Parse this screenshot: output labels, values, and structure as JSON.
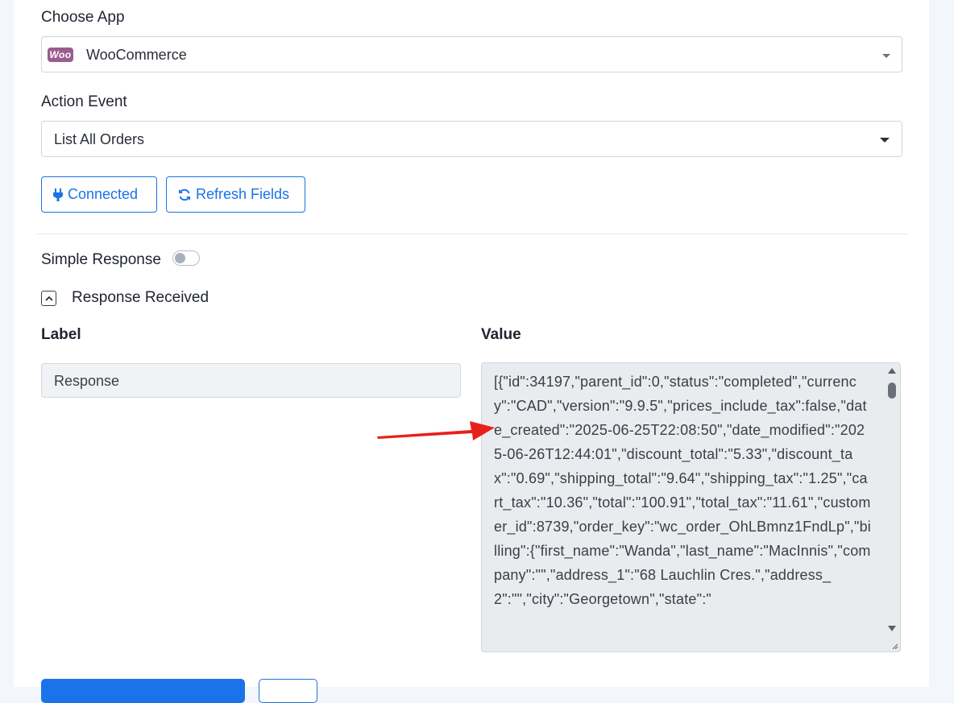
{
  "choose_app": {
    "label": "Choose App",
    "logo_text": "Woo",
    "selected": "WooCommerce"
  },
  "action_event": {
    "label": "Action Event",
    "selected": "List All Orders"
  },
  "buttons": {
    "connected": "Connected",
    "refresh": "Refresh Fields"
  },
  "simple_response": {
    "label": "Simple Response",
    "enabled": false
  },
  "response_received": {
    "label": "Response Received"
  },
  "table": {
    "label_header": "Label",
    "value_header": "Value",
    "row_label": "Response",
    "row_value": "[{\"id\":34197,\"parent_id\":0,\"status\":\"completed\",\"currency\":\"CAD\",\"version\":\"9.9.5\",\"prices_include_tax\":false,\"date_created\":\"2025-06-25T22:08:50\",\"date_modified\":\"2025-06-26T12:44:01\",\"discount_total\":\"5.33\",\"discount_tax\":\"0.69\",\"shipping_total\":\"9.64\",\"shipping_tax\":\"1.25\",\"cart_tax\":\"10.36\",\"total\":\"100.91\",\"total_tax\":\"11.61\",\"customer_id\":8739,\"order_key\":\"wc_order_OhLBmnz1FndLp\",\"billing\":{\"first_name\":\"Wanda\",\"last_name\":\"MacInnis\",\"company\":\"\",\"address_1\":\"68 Lauchlin Cres.\",\"address_2\":\"\",\"city\":\"Georgetown\",\"state\":\""
  },
  "colors": {
    "accent": "#1a73e8",
    "woo_purple": "#9b5c8f",
    "arrow": "#e8201a"
  }
}
